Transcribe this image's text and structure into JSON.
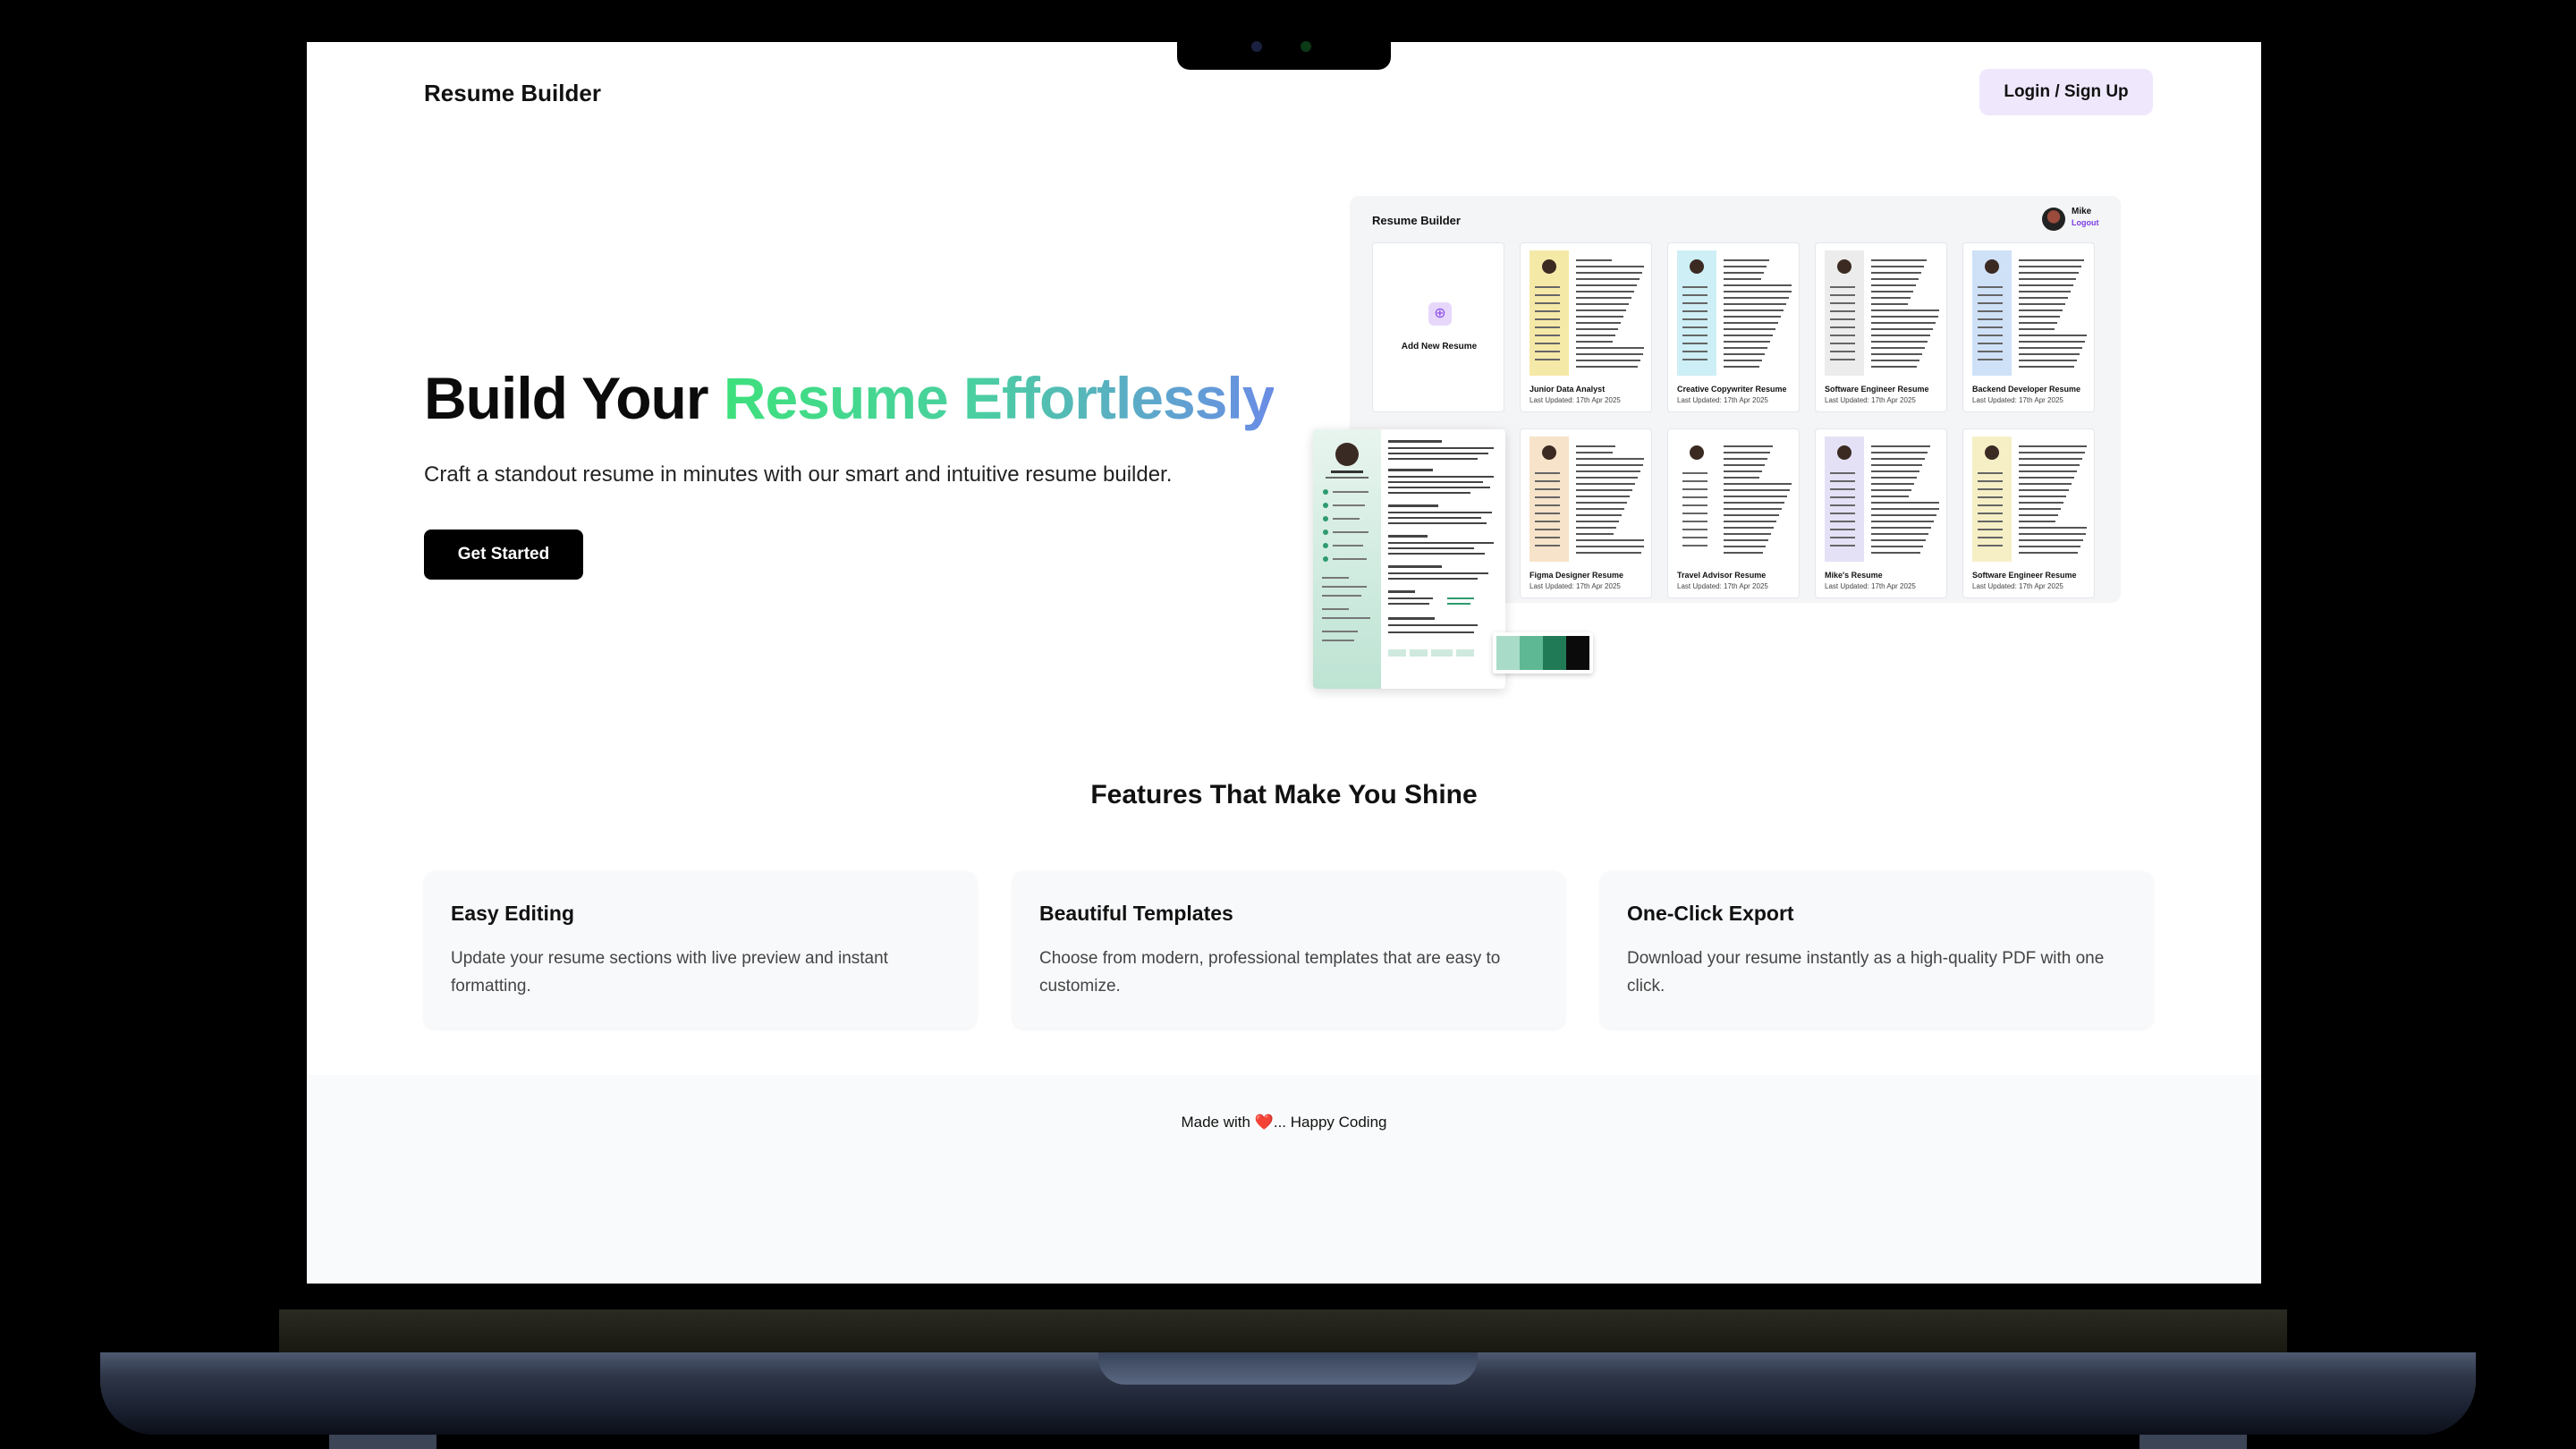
{
  "nav": {
    "brand": "Resume Builder",
    "login_label": "Login / Sign Up"
  },
  "hero": {
    "title_plain": "Build Your ",
    "title_gradient": "Resume Effortlessly",
    "subtitle": "Craft a standout resume in minutes with our smart and intuitive resume builder.",
    "cta_label": "Get Started"
  },
  "preview": {
    "brand": "Resume Builder",
    "user": "Mike",
    "logout": "Logout",
    "add_label": "Add New Resume",
    "cards": [
      {
        "name": "Junior Data Analyst",
        "date": "Last Updated: 17th Apr 2025",
        "accent": "#f5e9a8"
      },
      {
        "name": "Creative Copywriter Resume",
        "date": "Last Updated: 17th Apr 2025",
        "accent": "#cdeff5"
      },
      {
        "name": "Software Engineer Resume",
        "date": "Last Updated: 17th Apr 2025",
        "accent": "#ececec"
      },
      {
        "name": "Backend Developer Resume",
        "date": "Last Updated: 17th Apr 2025",
        "accent": "#cfe1f7"
      },
      {
        "name": "Figma Designer Resume",
        "date": "Last Updated: 17th Apr 2025",
        "accent": "#f7e3c9"
      },
      {
        "name": "Travel Advisor Resume",
        "date": "Last Updated: 17th Apr 2025",
        "accent": "#ffffff"
      },
      {
        "name": "Mike's Resume",
        "date": "Last Updated: 17th Apr 2025",
        "accent": "#e4e1f7"
      },
      {
        "name": "Software Engineer Resume",
        "date": "Last Updated: 17th Apr 2025",
        "accent": "#f6efc6"
      }
    ],
    "swatch_colors": [
      "#a8dcc8",
      "#5fb894",
      "#1f7a55",
      "#0b0b0b"
    ]
  },
  "features": {
    "title": "Features That Make You Shine",
    "items": [
      {
        "title": "Easy Editing",
        "desc": "Update your resume sections with live preview and instant formatting."
      },
      {
        "title": "Beautiful Templates",
        "desc": "Choose from modern, professional templates that are easy to customize."
      },
      {
        "title": "One-Click Export",
        "desc": "Download your resume instantly as a high-quality PDF with one click."
      }
    ]
  },
  "footer": {
    "prefix": "Made with ",
    "heart": "❤️",
    "suffix": "... Happy Coding"
  }
}
